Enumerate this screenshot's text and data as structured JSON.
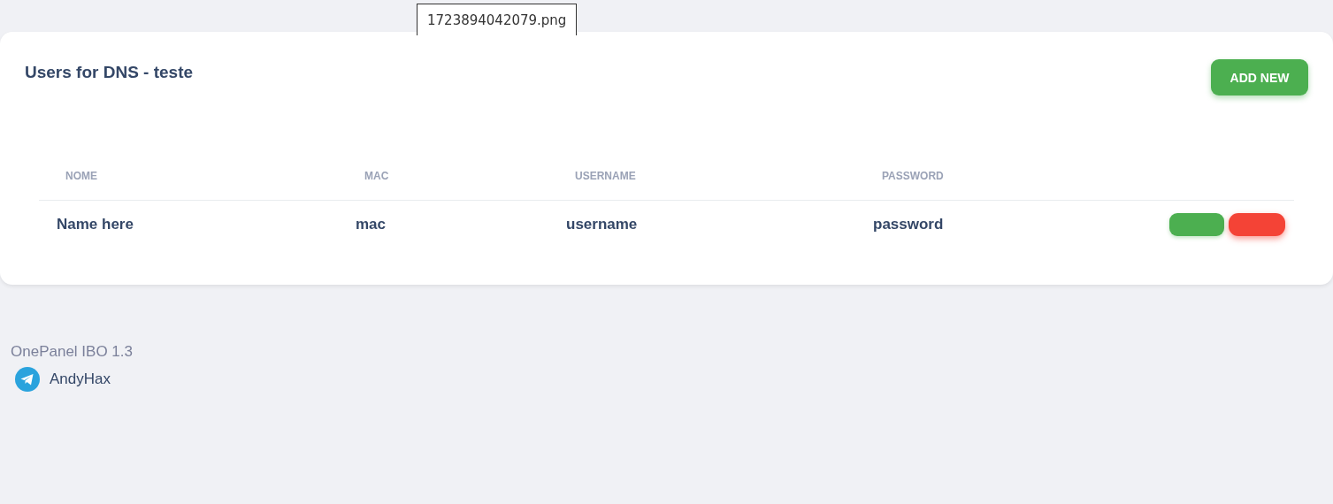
{
  "file_label": "1723894042079.png",
  "card": {
    "title": "Users for DNS - teste",
    "add_button": "ADD NEW"
  },
  "table": {
    "columns": [
      "NOME",
      "MAC",
      "USERNAME",
      "PASSWORD"
    ],
    "rows": [
      {
        "cells": [
          "Name here",
          "mac",
          "username",
          "password"
        ],
        "actions": [
          {
            "kind": "edit",
            "color": "#4caf50"
          },
          {
            "kind": "delete",
            "color": "#f44336"
          }
        ]
      }
    ]
  },
  "footer": {
    "version": "OnePanel IBO 1.3",
    "contact": "AndyHax"
  }
}
